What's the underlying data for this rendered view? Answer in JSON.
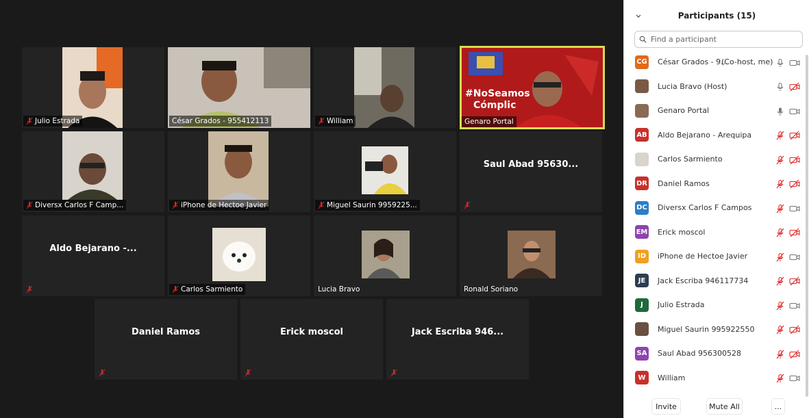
{
  "gallery": {
    "tiles": [
      {
        "name": "Julio Estrada",
        "muted": true
      },
      {
        "name": "César Grados - 955412113",
        "muted": false
      },
      {
        "name": "William",
        "muted": true
      },
      {
        "name": "Genaro Portal",
        "muted": false,
        "active": true,
        "banner_line1": "#NoSeamos",
        "banner_line2": "Cómplic"
      },
      {
        "name": "Diversx Carlos F Camp...",
        "muted": true
      },
      {
        "name": "iPhone de Hectoe Javier",
        "muted": true
      },
      {
        "name": "Miguel Saurin 9959225...",
        "muted": true
      },
      {
        "name": "",
        "center_name": "Saul Abad 95630...",
        "muted": true
      },
      {
        "name": "",
        "center_name": "Aldo Bejarano -...",
        "muted": true
      },
      {
        "name": "Carlos Sarmiento",
        "muted": true
      },
      {
        "name": "Lucia Bravo",
        "muted": false
      },
      {
        "name": "Ronald Soriano",
        "muted": false
      },
      {
        "name": "",
        "center_name": "Daniel Ramos",
        "muted": true
      },
      {
        "name": "",
        "center_name": "Erick moscol",
        "muted": true
      },
      {
        "name": "",
        "center_name": "Jack Escriba 946...",
        "muted": true
      }
    ]
  },
  "panel": {
    "title": "Participants (15)",
    "search_placeholder": "Find a participant",
    "participants": [
      {
        "initials": "CG",
        "color": "#e06a1b",
        "name": "César Grados - 9...",
        "role": "(Co-host, me)",
        "mic": "on",
        "video": "on"
      },
      {
        "initials": "",
        "photo": true,
        "color": "#7a5a45",
        "name": "Lucia Bravo (Host)",
        "role": "",
        "mic": "on",
        "video": "off"
      },
      {
        "initials": "",
        "photo": true,
        "color": "#8a6a55",
        "name": "Genaro Portal",
        "role": "",
        "mic": "active",
        "video": "on"
      },
      {
        "initials": "AB",
        "color": "#c9302c",
        "name": "Aldo Bejarano - Arequipa",
        "role": "",
        "mic": "off",
        "video": "off"
      },
      {
        "initials": "",
        "photo": true,
        "color": "#d9d4cc",
        "name": "Carlos Sarmiento",
        "role": "",
        "mic": "off",
        "video": "off"
      },
      {
        "initials": "DR",
        "color": "#c9302c",
        "name": "Daniel Ramos",
        "role": "",
        "mic": "off",
        "video": "off"
      },
      {
        "initials": "DC",
        "color": "#2d7dc8",
        "name": "Diversx Carlos F Campos",
        "role": "",
        "mic": "off",
        "video": "on"
      },
      {
        "initials": "EM",
        "color": "#8e44ad",
        "name": "Erick moscol",
        "role": "",
        "mic": "off",
        "video": "off"
      },
      {
        "initials": "ID",
        "color": "#f0a020",
        "name": "iPhone de Hectoe Javier",
        "role": "",
        "mic": "off",
        "video": "on"
      },
      {
        "initials": "JE",
        "color": "#2c3e50",
        "name": "Jack Escriba 946117734",
        "role": "",
        "mic": "off",
        "video": "off"
      },
      {
        "initials": "J",
        "color": "#1e6a3a",
        "name": "Julio Estrada",
        "role": "",
        "mic": "off",
        "video": "on"
      },
      {
        "initials": "",
        "photo": true,
        "color": "#6a5040",
        "name": "Miguel Saurin 995922550",
        "role": "",
        "mic": "off",
        "video": "off"
      },
      {
        "initials": "SA",
        "color": "#8e44ad",
        "name": "Saul Abad 956300528",
        "role": "",
        "mic": "off",
        "video": "off"
      },
      {
        "initials": "W",
        "color": "#c9302c",
        "name": "William",
        "role": "",
        "mic": "off",
        "video": "on"
      }
    ],
    "invite_label": "Invite",
    "mute_all_label": "Mute All",
    "more_label": "..."
  }
}
